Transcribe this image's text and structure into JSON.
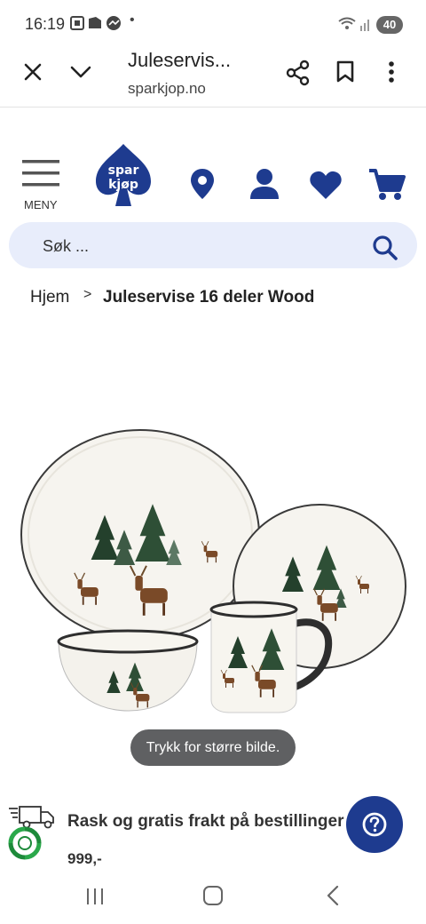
{
  "status_bar": {
    "time": "16:19",
    "battery": "40"
  },
  "browser": {
    "title": "Juleservis...",
    "domain": "sparkjop.no"
  },
  "header": {
    "logo_text_line1": "spar",
    "logo_text_line2": "kjøp",
    "menu_label": "MENY",
    "brand_color": "#1e3b8f"
  },
  "search": {
    "placeholder": "Søk ..."
  },
  "breadcrumb": {
    "home": "Hjem",
    "separator": ">",
    "current": "Juleservise 16 deler Wood"
  },
  "product": {
    "image_hint": "Trykk for større bilde."
  },
  "shipping": {
    "text": "Rask og gratis frakt på bestillinger",
    "price": "999,-"
  },
  "help": {
    "icon": "question-icon"
  }
}
